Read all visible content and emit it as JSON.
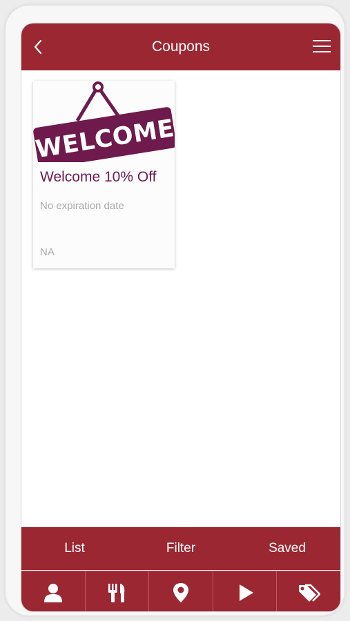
{
  "header": {
    "title": "Coupons",
    "back_icon": "chevron-left-icon",
    "menu_icon": "hamburger-menu-icon"
  },
  "coupons": [
    {
      "image_text": "WELCOME",
      "title": "Welcome 10% Off",
      "expiry": "No expiration date",
      "code": "NA"
    }
  ],
  "segments": {
    "list": "List",
    "filter": "Filter",
    "saved": "Saved"
  },
  "tabs": [
    {
      "icon": "user-icon"
    },
    {
      "icon": "fork-knife-icon"
    },
    {
      "icon": "location-pin-icon"
    },
    {
      "icon": "play-icon"
    },
    {
      "icon": "tags-icon"
    }
  ],
  "colors": {
    "brand": "#9b2732",
    "accent": "#6f1a4d",
    "muted_text": "#a9a9a9"
  }
}
